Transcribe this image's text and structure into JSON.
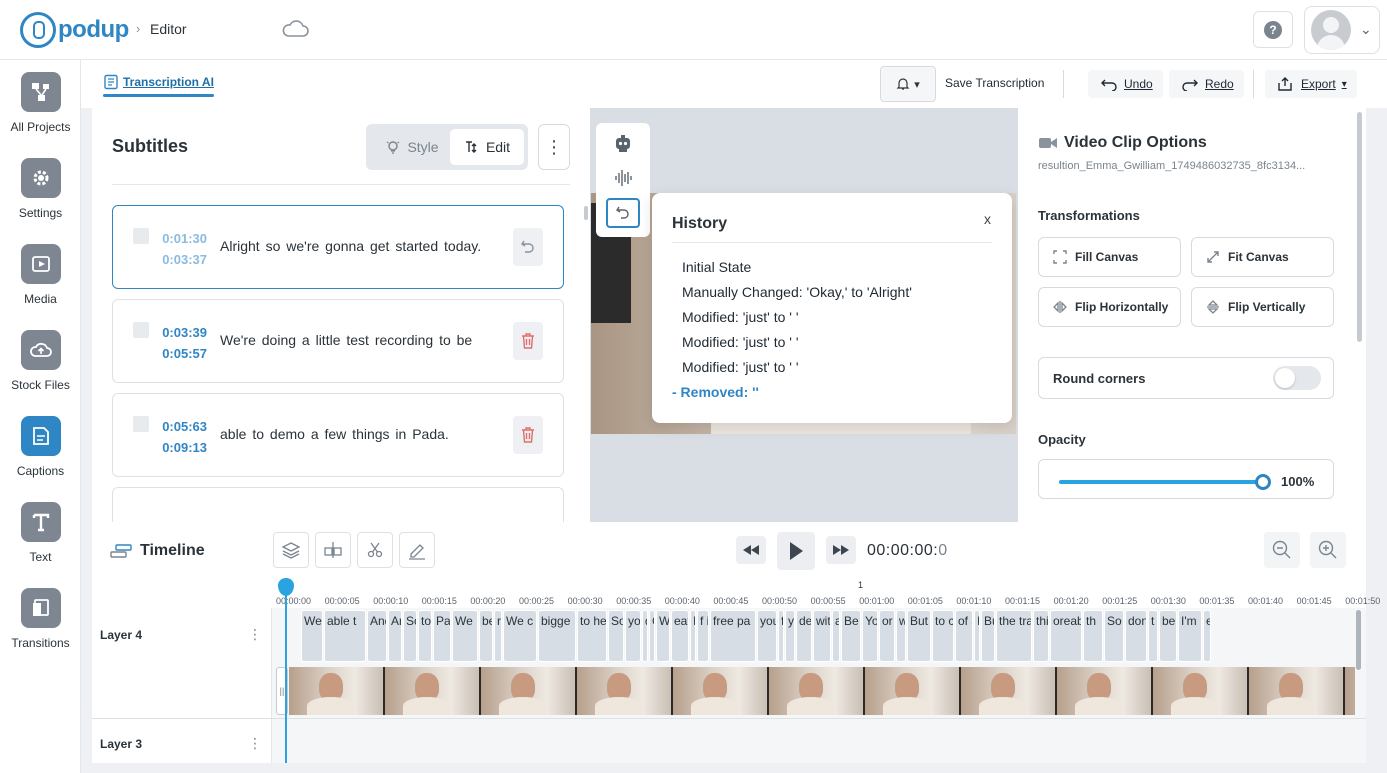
{
  "header": {
    "logo_text": "podup",
    "breadcrumb": "Editor"
  },
  "nav": [
    {
      "label": "All Projects",
      "icon": "projects-icon"
    },
    {
      "label": "Settings",
      "icon": "gear-icon"
    },
    {
      "label": "Media",
      "icon": "media-icon"
    },
    {
      "label": "Stock Files",
      "icon": "cloud-icon"
    },
    {
      "label": "Captions",
      "icon": "captions-icon",
      "active": true
    },
    {
      "label": "Text",
      "icon": "text-icon"
    },
    {
      "label": "Transitions",
      "icon": "transitions-icon"
    }
  ],
  "toolbar": {
    "transcription_tab": "Transcription AI",
    "save": "Save Transcription",
    "undo": "Undo",
    "redo": "Redo",
    "export": "Export"
  },
  "subtitles": {
    "title": "Subtitles",
    "style_label": "Style",
    "edit_label": "Edit",
    "items": [
      {
        "start": "0:01:30",
        "end": "0:03:37",
        "text": "Alright so we're gonna get started today."
      },
      {
        "start": "0:03:39",
        "end": "0:05:57",
        "text": "We're doing a little test recording to be"
      },
      {
        "start": "0:05:63",
        "end": "0:09:13",
        "text": "able to demo a few things in Pada."
      }
    ]
  },
  "history": {
    "title": "History",
    "close": "x",
    "items": [
      "Initial State",
      "Manually Changed: 'Okay,' to 'Alright'",
      "Modified: 'just' to ' '",
      "Modified: 'just' to ' '",
      "Modified: 'just' to ' '"
    ],
    "removed": "- Removed: ''"
  },
  "options": {
    "title": "Video Clip Options",
    "filename": "resultion_Emma_Gwilliam_1749486032735_8fc3134...",
    "transformations_label": "Transformations",
    "fill_canvas": "Fill Canvas",
    "fit_canvas": "Fit Canvas",
    "flip_h": "Flip Horizontally",
    "flip_v": "Flip Vertically",
    "round_corners": "Round corners",
    "round_corners_on": false,
    "opacity_label": "Opacity",
    "opacity_value": "100%",
    "opacity_fraction": 1.0
  },
  "timeline": {
    "title": "Timeline",
    "timecode_main": "00:00:00:",
    "timecode_frame": "0",
    "ruler_marker": "1",
    "ticks": [
      "00:00:00",
      "00:00:05",
      "00:00:10",
      "00:00:15",
      "00:00:20",
      "00:00:25",
      "00:00:30",
      "00:00:35",
      "00:00:40",
      "00:00:45",
      "00:00:50",
      "00:00:55",
      "00:01:00",
      "00:01:05",
      "00:01:10",
      "00:01:15",
      "00:01:20",
      "00:01:25",
      "00:01:30",
      "00:01:35",
      "00:01:40",
      "00:01:45",
      "00:01:50"
    ],
    "layers": [
      "Layer 4",
      "Layer 3"
    ],
    "caption_clips": [
      "We",
      "able t",
      "And",
      "Ar",
      "So",
      "to",
      "Pa",
      "We",
      "be",
      "r",
      "We c",
      "bigge",
      "to he",
      "So",
      "you",
      "d",
      "C",
      "W",
      "eat",
      "I",
      "f i",
      "free pa",
      "you",
      "f",
      "y",
      "de",
      "wit",
      "a",
      "Be",
      "Yo",
      "or",
      "w",
      "But",
      "to c",
      "of s",
      "I",
      "Bu",
      "the tra",
      "thi",
      "oreab",
      "th",
      "So",
      "don",
      "t",
      "be",
      "I'm",
      "e"
    ]
  }
}
